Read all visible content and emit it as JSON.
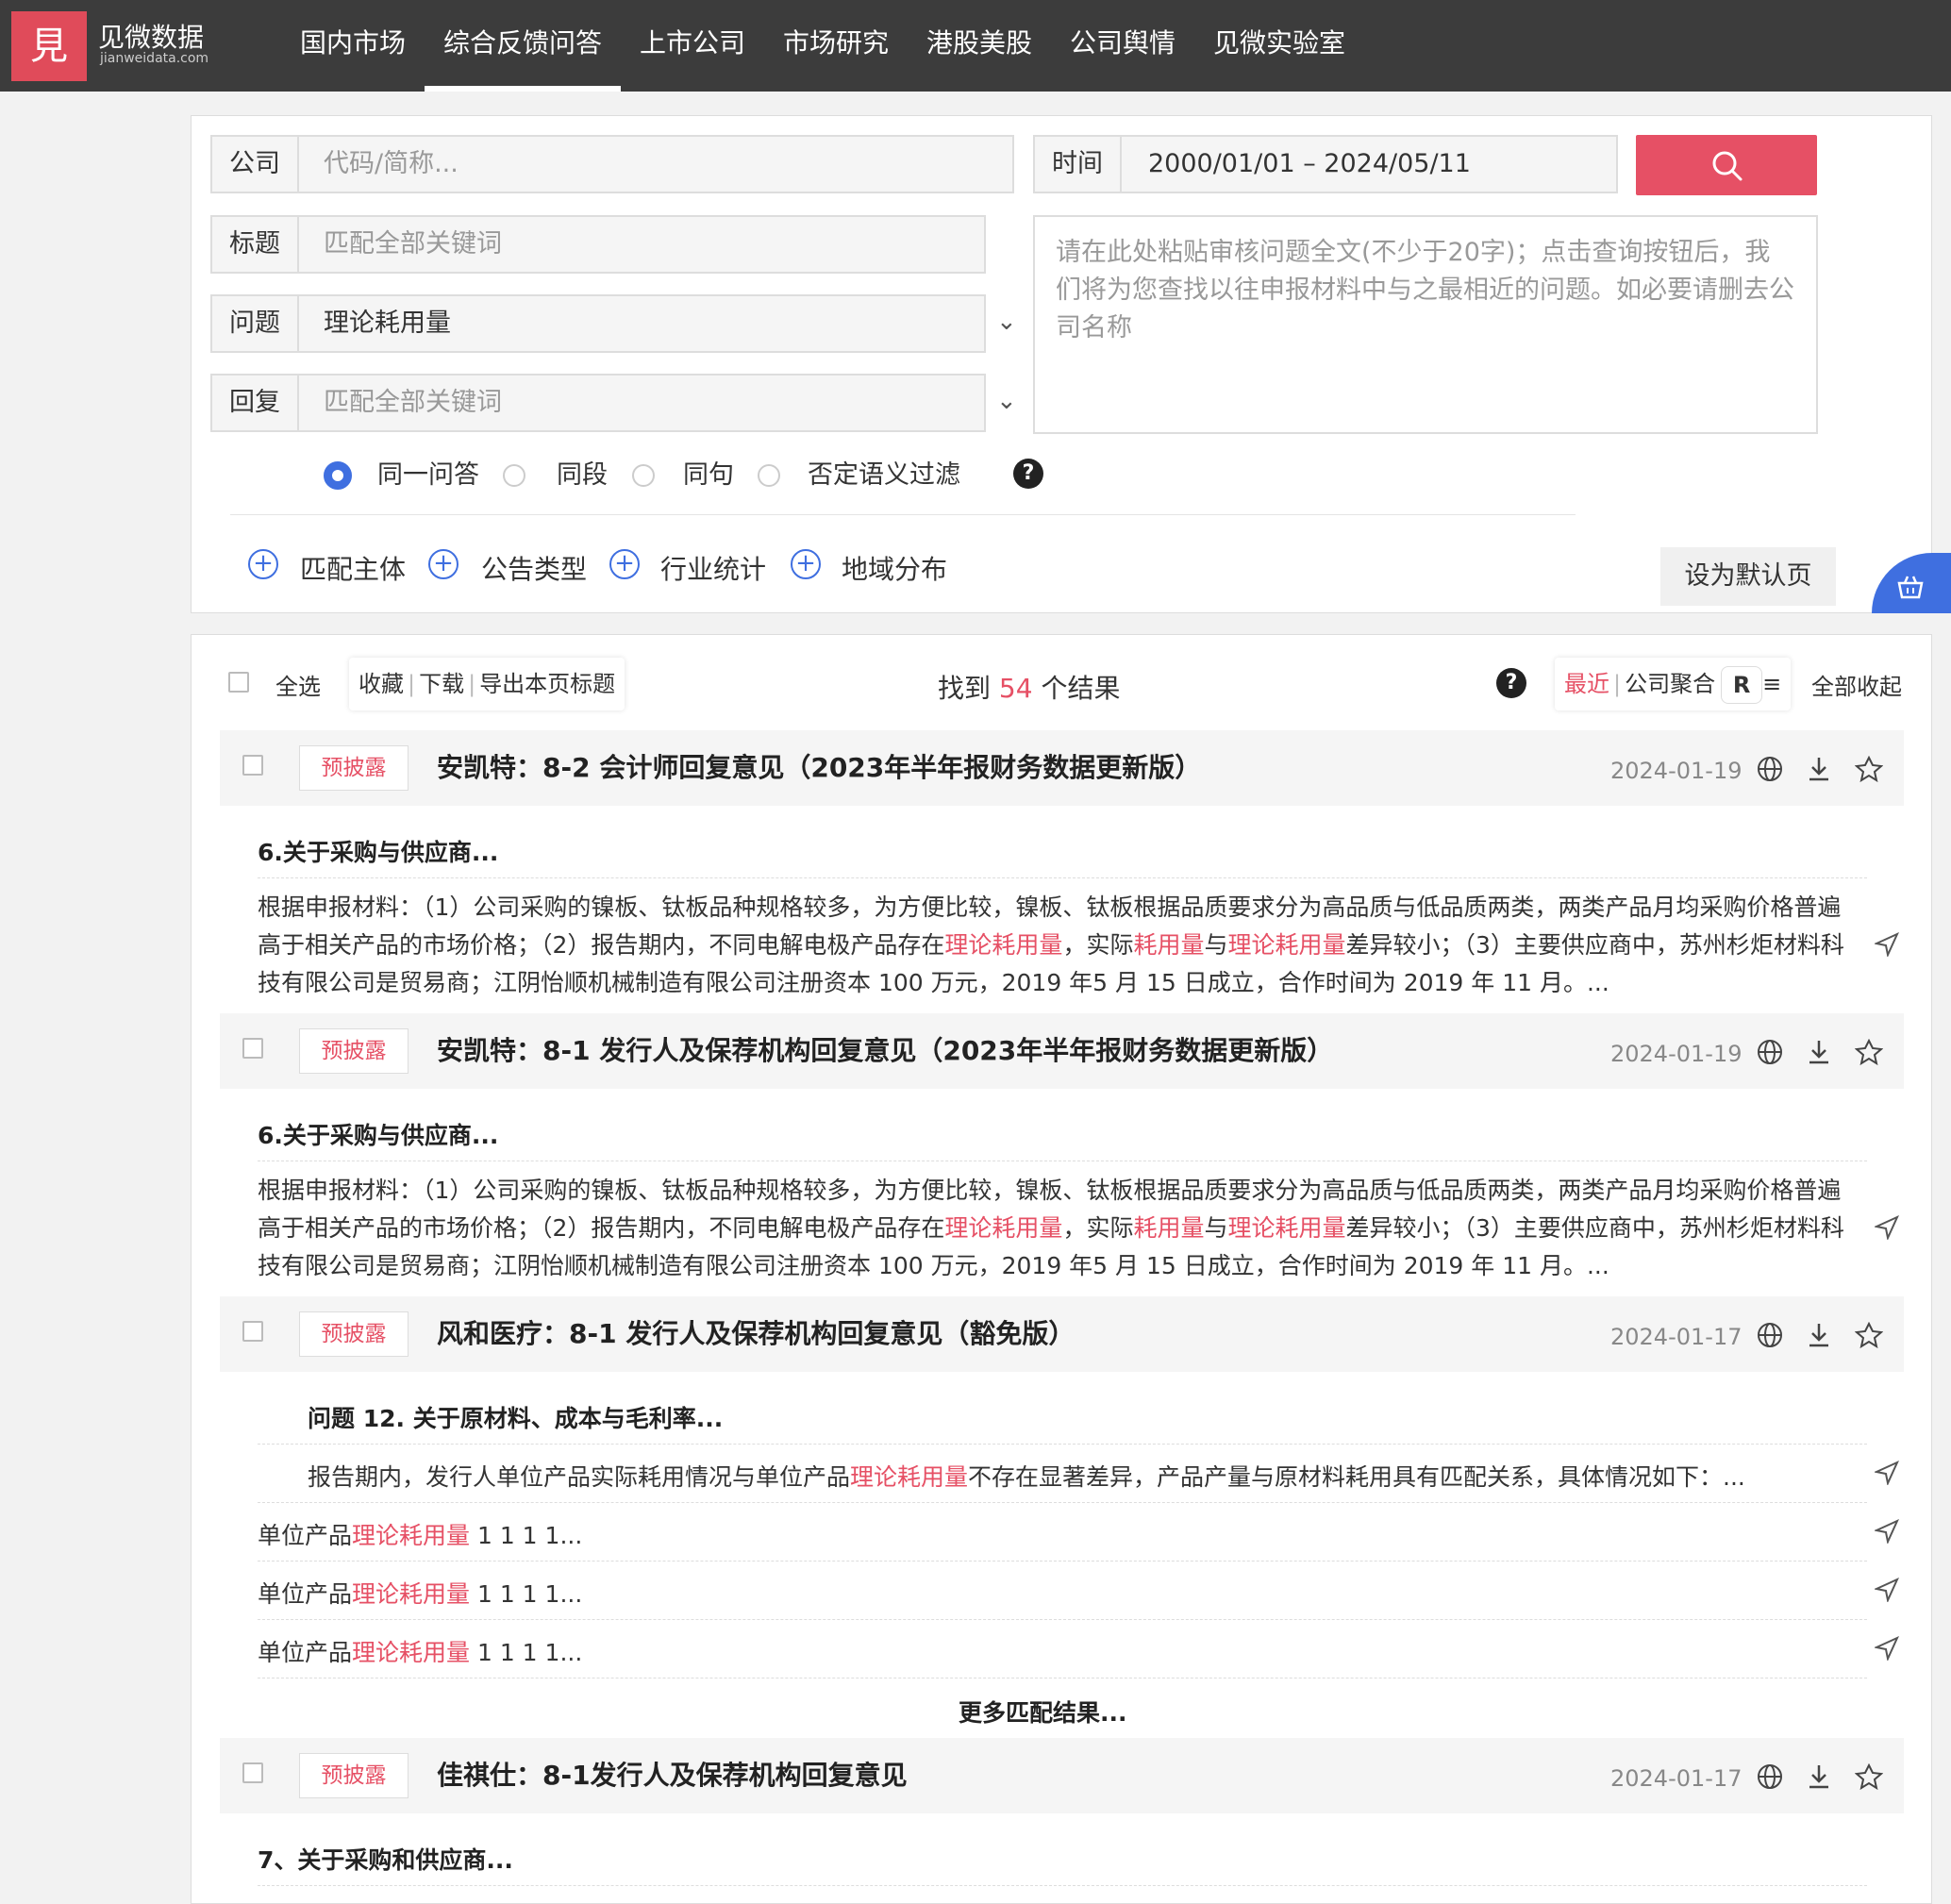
{
  "nav": {
    "logo_glyph": "見",
    "logo_name": "见微数据",
    "logo_domain": "jianweidata.com",
    "items": [
      "国内市场",
      "综合反馈问答",
      "上市公司",
      "市场研究",
      "港股美股",
      "公司舆情",
      "见微实验室"
    ],
    "active_index": 1
  },
  "search": {
    "company_label": "公司",
    "company_placeholder": "代码/简称...",
    "time_label": "时间",
    "time_value": "2000/01/01 – 2024/05/11",
    "title_label": "标题",
    "title_placeholder": "匹配全部关键词",
    "question_label": "问题",
    "question_value": "理论耗用量",
    "reply_label": "回复",
    "reply_placeholder": "匹配全部关键词",
    "textarea_placeholder": "请在此处粘贴审核问题全文(不少于20字)；点击查询按钮后，我们将为您查找以往申报材料中与之最相近的问题。如必要请删去公司名称",
    "scope_options": [
      "同一问答",
      "同段",
      "同句",
      "否定语义过滤"
    ],
    "scope_selected": 0,
    "filters": [
      "匹配主体",
      "公告类型",
      "行业统计",
      "地域分布"
    ],
    "default_button": "设为默认页",
    "accent": "#e65065",
    "blue": "#3f6fe0"
  },
  "toolbar": {
    "select_all": "全选",
    "collect": "收藏",
    "download": "下载",
    "export_titles": "导出本页标题",
    "found_prefix": "找到",
    "found_count": "54",
    "found_suffix": "个结果",
    "sort_recent": "最近",
    "sort_company": "公司聚合",
    "sort_badge": "R",
    "sort_tail": "≡",
    "collapse_all": "全部收起"
  },
  "results": [
    {
      "tag": "预披露",
      "title": "安凯特：8-2 会计师回复意见（2023年半年报财务数据更新版）",
      "date": "2024-01-19",
      "section": "6.关于采购与供应商...",
      "para_1a": "根据申报材料：（1）公司采购的镍板、钛板品种规格较多，为方便比较，镍板、钛板根据品质要求分为高品质与低品质两类，两类产品月均采购价格普遍高于相关产品的市场价格；（2）报告期内，不同电解电极产品存在",
      "hl_1": "理论耗用量",
      "para_1b": "，实际",
      "hl_2": "耗用量",
      "para_1c": "与",
      "hl_3": "理论耗用量",
      "para_1d": "差异较小；（3）主要供应商中，苏州杉炬材料科技有限公司是贸易商；江阴怡顺机械制造有限公司注册资本 100 万元，2019 年5 月 15 日成立，合作时间为 2019 年 11 月。..."
    },
    {
      "tag": "预披露",
      "title": "安凯特：8-1 发行人及保荐机构回复意见（2023年半年报财务数据更新版）",
      "date": "2024-01-19",
      "section": "6.关于采购与供应商...",
      "para_1a": "根据申报材料：（1）公司采购的镍板、钛板品种规格较多，为方便比较，镍板、钛板根据品质要求分为高品质与低品质两类，两类产品月均采购价格普遍高于相关产品的市场价格；（2）报告期内，不同电解电极产品存在",
      "hl_1": "理论耗用量",
      "para_1b": "，实际",
      "hl_2": "耗用量",
      "para_1c": "与",
      "hl_3": "理论耗用量",
      "para_1d": "差异较小；（3）主要供应商中，苏州杉炬材料科技有限公司是贸易商；江阴怡顺机械制造有限公司注册资本 100 万元，2019 年5 月 15 日成立，合作时间为 2019 年 11 月。..."
    },
    {
      "tag": "预披露",
      "title": "风和医疗：8-1 发行人及保荐机构回复意见（豁免版）",
      "date": "2024-01-17",
      "section": "问题 12. 关于原材料、成本与毛利率...",
      "line_a": "报告期内，发行人单位产品实际耗用情况与单位产品",
      "line_hl": "理论耗用量",
      "line_b": "不存在显著差异，产品产量与原材料耗用具有匹配关系，具体情况如下：...",
      "unit_prefix": "单位产品",
      "unit_hl": "理论耗用量",
      "unit_suffix": " 1 1 1 1...",
      "more": "更多匹配结果..."
    },
    {
      "tag": "预披露",
      "title": "佳祺仕：8-1发行人及保荐机构回复意见",
      "date": "2024-01-17",
      "section": "7、关于采购和供应商..."
    }
  ]
}
